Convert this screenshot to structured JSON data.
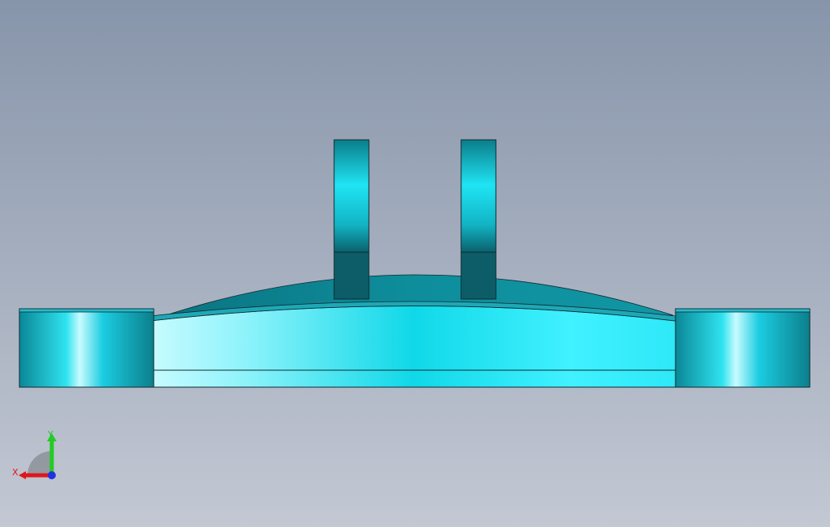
{
  "viewport": {
    "background_top": "#8795aa",
    "background_bottom": "#c3c8d3"
  },
  "model": {
    "body_color": "#19c9dc",
    "shadow_color": "#0a6f7a",
    "outline_color": "#0e2a30"
  },
  "triad": {
    "x_label": "X",
    "y_label": "Y",
    "x_color": "#e0161b",
    "y_color": "#22cc22",
    "z_color": "#2233dd"
  }
}
